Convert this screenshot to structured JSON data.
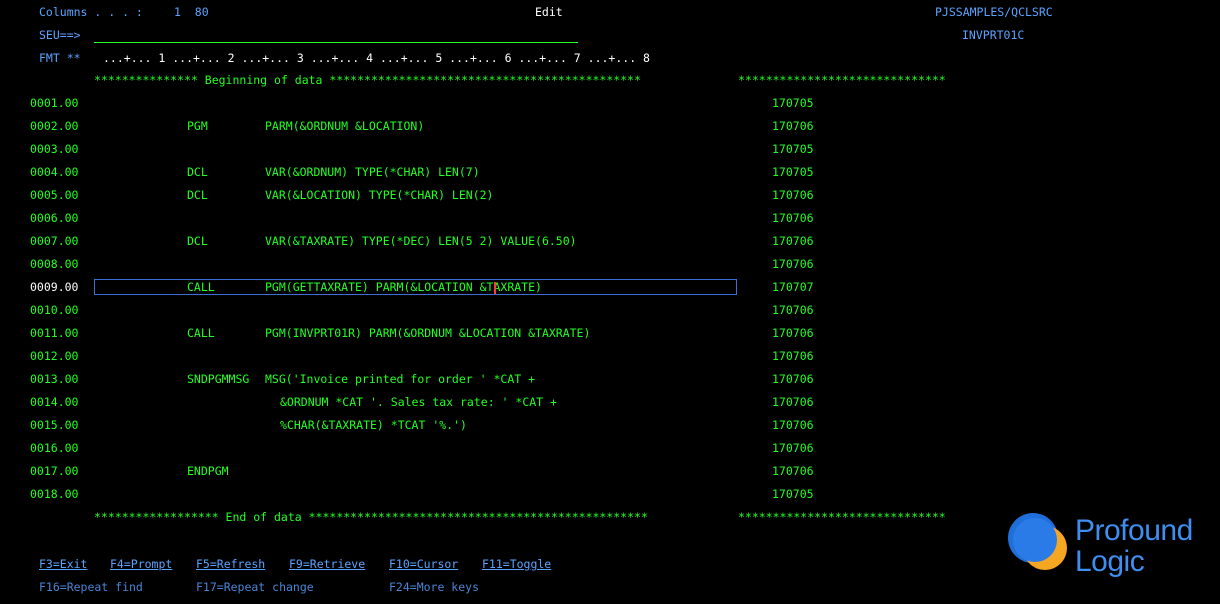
{
  "header": {
    "columns_label": "Columns . . . :",
    "columns_value": "1  80",
    "mode": "Edit",
    "source_file": "PJSSAMPLES/QCLSRC",
    "member": "INVPRT01C",
    "seu_prompt": "SEU==>",
    "fmt_label": "FMT **",
    "ruler": "...+... 1 ...+... 2 ...+... 3 ...+... 4 ...+... 5 ...+... 6 ...+... 7 ...+... 8"
  },
  "markers": {
    "begin": "*************** Beginning of data *********************************************",
    "begin_right": "******************************",
    "end": "****************** End of data *************************************************",
    "end_right": "******************************"
  },
  "lines": [
    {
      "seq": "0001.00",
      "op": "",
      "arg": "",
      "date": "170705"
    },
    {
      "seq": "0002.00",
      "op": "PGM",
      "arg": "PARM(&ORDNUM &LOCATION)",
      "date": "170706"
    },
    {
      "seq": "0003.00",
      "op": "",
      "arg": "",
      "date": "170705"
    },
    {
      "seq": "0004.00",
      "op": "DCL",
      "arg": "VAR(&ORDNUM) TYPE(*CHAR) LEN(7)",
      "date": "170705"
    },
    {
      "seq": "0005.00",
      "op": "DCL",
      "arg": "VAR(&LOCATION) TYPE(*CHAR) LEN(2)",
      "date": "170706"
    },
    {
      "seq": "0006.00",
      "op": "",
      "arg": "",
      "date": "170706"
    },
    {
      "seq": "0007.00",
      "op": "DCL",
      "arg": "VAR(&TAXRATE) TYPE(*DEC) LEN(5 2) VALUE(6.50)",
      "date": "170706"
    },
    {
      "seq": "0008.00",
      "op": "",
      "arg": "",
      "date": "170706"
    },
    {
      "seq": "0009.00",
      "op": "CALL",
      "arg": "PGM(GETTAXRATE) PARM(&LOCATION &TAXRATE)",
      "date": "170707"
    },
    {
      "seq": "0010.00",
      "op": "",
      "arg": "",
      "date": "170706"
    },
    {
      "seq": "0011.00",
      "op": "CALL",
      "arg": "PGM(INVPRT01R) PARM(&ORDNUM &LOCATION &TAXRATE)",
      "date": "170706"
    },
    {
      "seq": "0012.00",
      "op": "",
      "arg": "",
      "date": "170706"
    },
    {
      "seq": "0013.00",
      "op": "SNDPGMMSG",
      "arg": "MSG('Invoice printed for order ' *CAT +",
      "date": "170706"
    },
    {
      "seq": "0014.00",
      "op": "",
      "arg2": "&ORDNUM *CAT '. Sales tax rate: ' *CAT +",
      "date": "170706"
    },
    {
      "seq": "0015.00",
      "op": "",
      "arg2": "%CHAR(&TAXRATE) *TCAT '%.')",
      "date": "170706"
    },
    {
      "seq": "0016.00",
      "op": "",
      "arg": "",
      "date": "170706"
    },
    {
      "seq": "0017.00",
      "op": "ENDPGM",
      "arg": "",
      "date": "170706"
    },
    {
      "seq": "0018.00",
      "op": "",
      "arg": "",
      "date": "170705"
    }
  ],
  "fkeys_row1": [
    "F3=Exit",
    "F4=Prompt",
    "F5=Refresh",
    "F9=Retrieve",
    "F10=Cursor",
    "F11=Toggle"
  ],
  "fkeys_row2": [
    "F16=Repeat find",
    "F17=Repeat change",
    "F24=More keys"
  ],
  "logo": {
    "line1": "Profound",
    "line2": "Logic"
  },
  "colors": {
    "text": "#22ff22",
    "blue": "#5aa3ff",
    "highlight_box": "#3d6fd6",
    "logo": "#3f8ef0",
    "background": "#000000"
  }
}
